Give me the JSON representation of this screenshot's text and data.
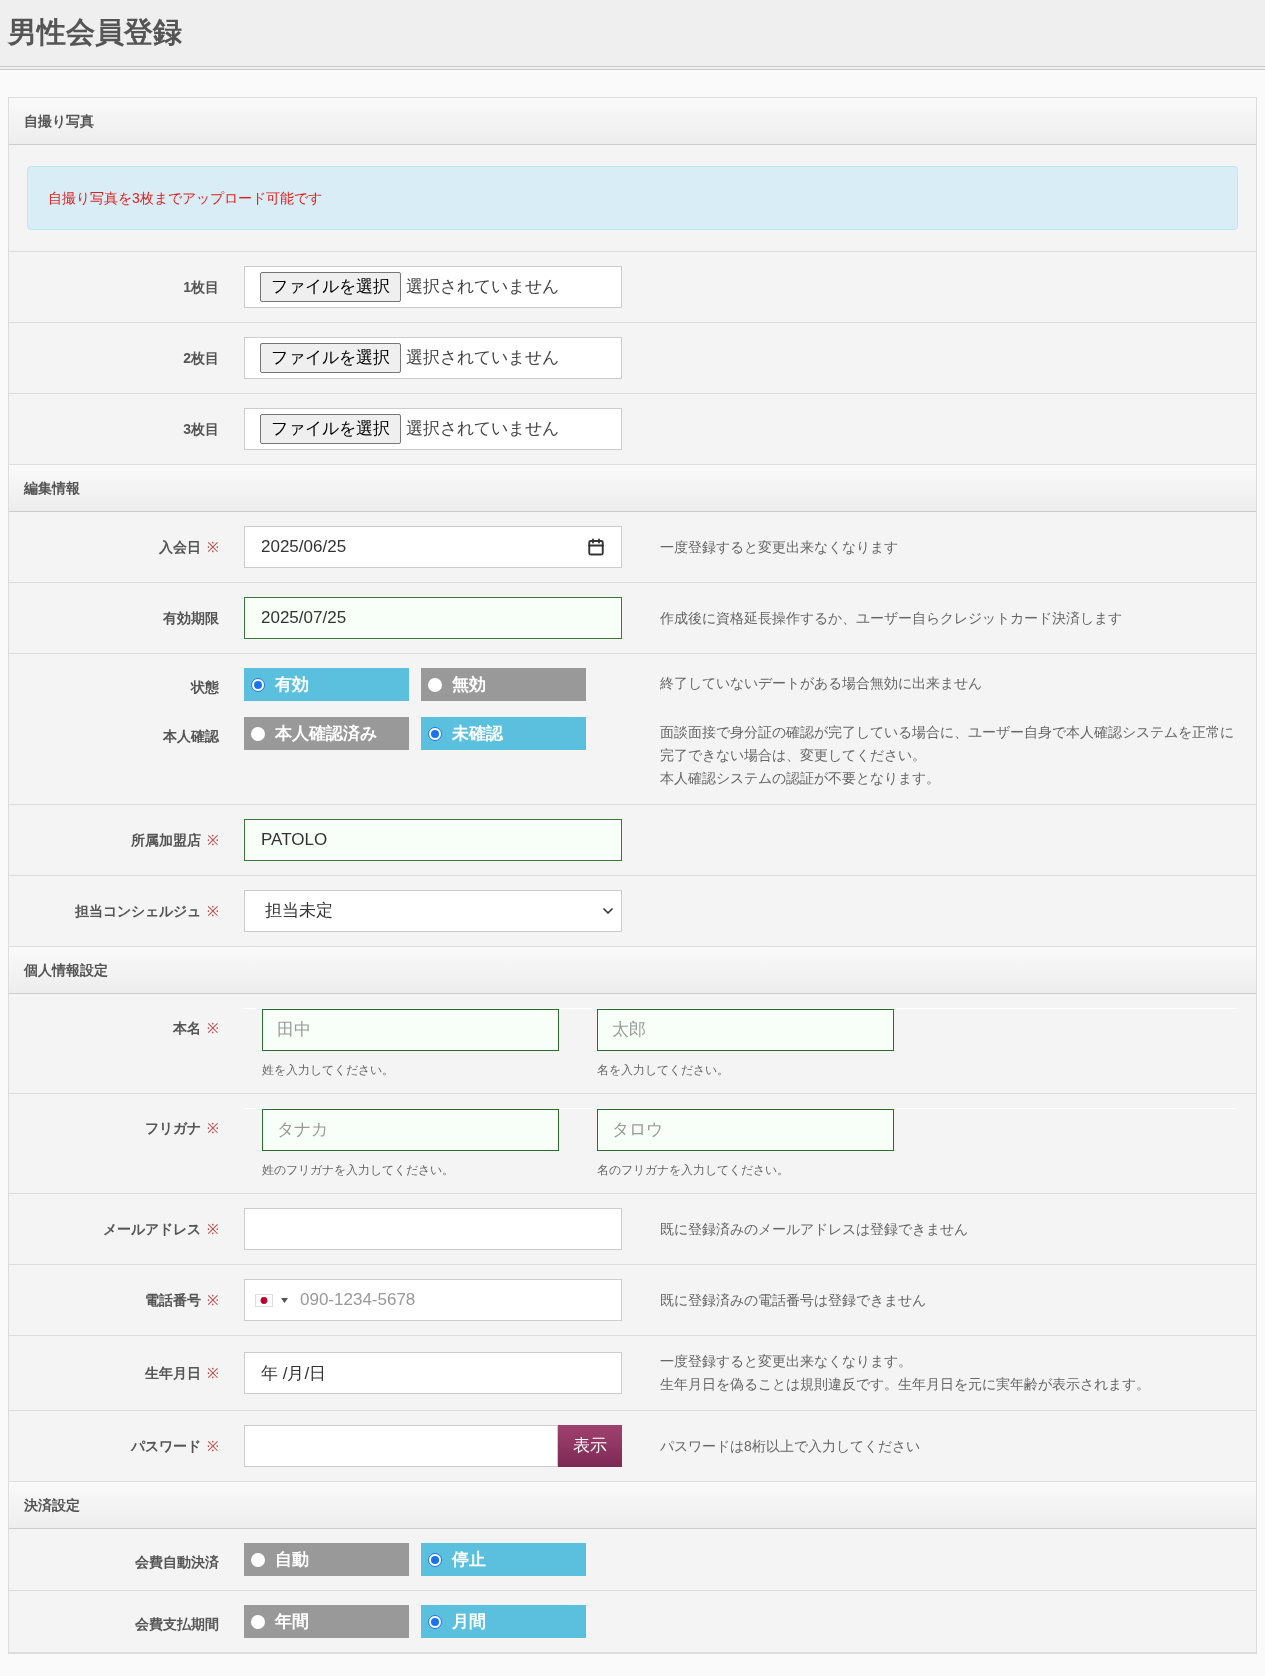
{
  "page_title": "男性会員登録",
  "sections": [
    {
      "title": "自撮り写真",
      "alert": "自撮り写真を3枚までアップロード可能です",
      "rows": [
        {
          "kind": "file",
          "label": "1枚目",
          "button": "ファイルを選択",
          "status": "選択されていません"
        },
        {
          "kind": "file",
          "label": "2枚目",
          "button": "ファイルを選択",
          "status": "選択されていません"
        },
        {
          "kind": "file",
          "label": "3枚目",
          "button": "ファイルを選択",
          "status": "選択されていません"
        }
      ]
    },
    {
      "title": "編集情報",
      "rows": [
        {
          "kind": "date",
          "label": "入会日",
          "required": "※",
          "value": "2025/06/25",
          "help": [
            "一度登録すると変更出来なくなります"
          ]
        },
        {
          "kind": "text",
          "label": "有効期限",
          "value": "2025/07/25",
          "validated": true,
          "help": [
            "作成後に資格延長操作するか、ユーザー自らクレジットカード決済します"
          ]
        },
        {
          "kind": "radio",
          "groups": [
            {
              "label": "状態",
              "options": [
                {
                  "label": "有効",
                  "selected": true
                },
                {
                  "label": "無効",
                  "selected": false
                }
              ],
              "help": [
                "終了していないデートがある場合無効に出来ません"
              ]
            },
            {
              "label": "本人確認",
              "options": [
                {
                  "label": "本人確認済み",
                  "selected": false
                },
                {
                  "label": "未確認",
                  "selected": true
                }
              ],
              "help": [
                "面談面接で身分証の確認が完了している場合に、ユーザー自身で本人確認システムを正常に完了できない場合は、変更してください。",
                "本人確認システムの認証が不要となります。"
              ]
            }
          ]
        },
        {
          "kind": "text",
          "label": "所属加盟店",
          "required": "※",
          "value": "PATOLO",
          "validated": true
        },
        {
          "kind": "select",
          "label": "担当コンシェルジュ",
          "required": "※",
          "value": "担当未定"
        }
      ]
    },
    {
      "title": "個人情報設定",
      "rows": [
        {
          "kind": "name_pair",
          "label": "本名",
          "required": "※",
          "fields": [
            {
              "placeholder": "田中",
              "hint": "姓を入力してください。"
            },
            {
              "placeholder": "太郎",
              "hint": "名を入力してください。"
            }
          ]
        },
        {
          "kind": "name_pair",
          "label": "フリガナ",
          "required": "※",
          "fields": [
            {
              "placeholder": "タナカ",
              "hint": "姓のフリガナを入力してください。"
            },
            {
              "placeholder": "タロウ",
              "hint": "名のフリガナを入力してください。"
            }
          ]
        },
        {
          "kind": "text",
          "label": "メールアドレス",
          "required": "※",
          "value": "",
          "validated": false,
          "help": [
            "既に登録済みのメールアドレスは登録できません"
          ]
        },
        {
          "kind": "phone",
          "label": "電話番号",
          "required": "※",
          "placeholder": "090-1234-5678",
          "help": [
            "既に登録済みの電話番号は登録できません"
          ]
        },
        {
          "kind": "text",
          "label": "生年月日",
          "required": "※",
          "value": "年 /月/日",
          "validated": false,
          "help": [
            "一度登録すると変更出来なくなります。",
            "生年月日を偽ることは規則違反です。生年月日を元に実年齢が表示されます。"
          ]
        },
        {
          "kind": "password",
          "label": "パスワード",
          "required": "※",
          "button": "表示",
          "help": [
            "パスワードは8桁以上で入力してください"
          ]
        }
      ]
    },
    {
      "title": "決済設定",
      "rows": [
        {
          "kind": "radio",
          "groups": [
            {
              "label": "会費自動決済",
              "options": [
                {
                  "label": "自動",
                  "selected": false
                },
                {
                  "label": "停止",
                  "selected": true
                }
              ]
            }
          ]
        },
        {
          "kind": "radio",
          "groups": [
            {
              "label": "会費支払期間",
              "options": [
                {
                  "label": "年間",
                  "selected": false
                },
                {
                  "label": "月間",
                  "selected": true
                }
              ]
            }
          ]
        }
      ]
    }
  ]
}
